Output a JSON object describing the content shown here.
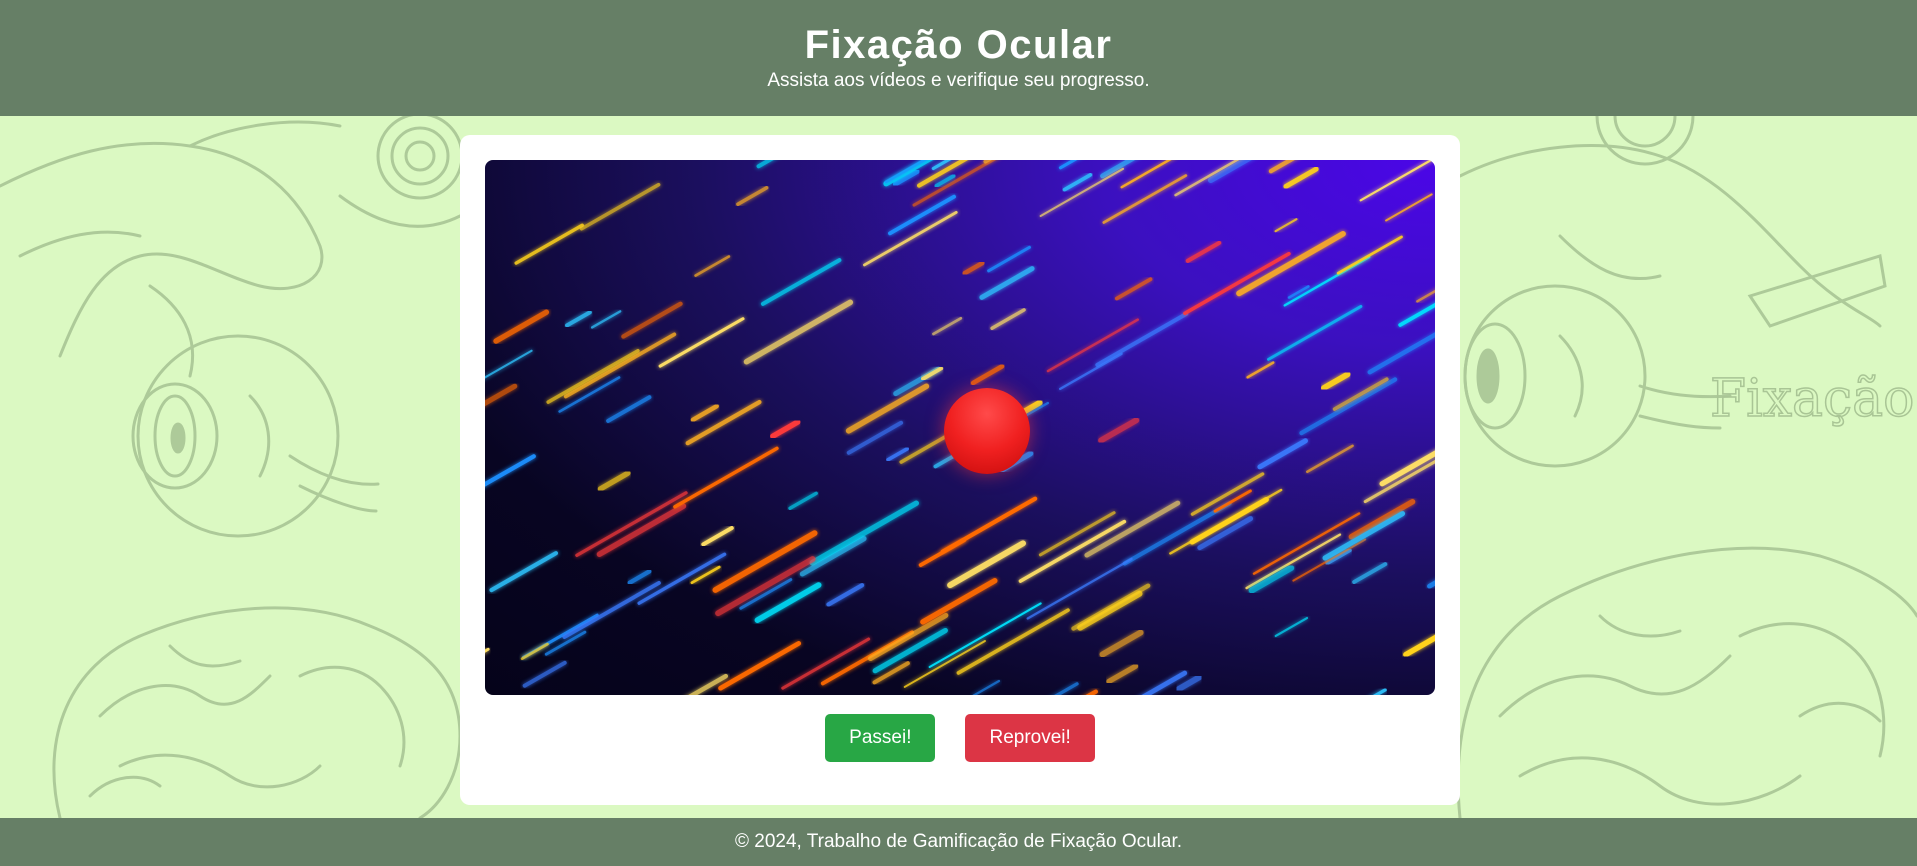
{
  "header": {
    "title": "Fixação Ocular",
    "subtitle": "Assista aos vídeos e verifique seu progresso."
  },
  "background": {
    "watermark_text": "Fixação"
  },
  "video": {
    "description_icon": "red-ball-target"
  },
  "buttons": {
    "pass_label": "Passei!",
    "fail_label": "Reprovei!"
  },
  "footer": {
    "text": "© 2024, Trabalho de Gamificação de Fixação Ocular."
  },
  "colors": {
    "header_bg": "#667f66",
    "page_bg": "#dbf9c2",
    "pass_button": "#28a745",
    "fail_button": "#dc3545"
  }
}
